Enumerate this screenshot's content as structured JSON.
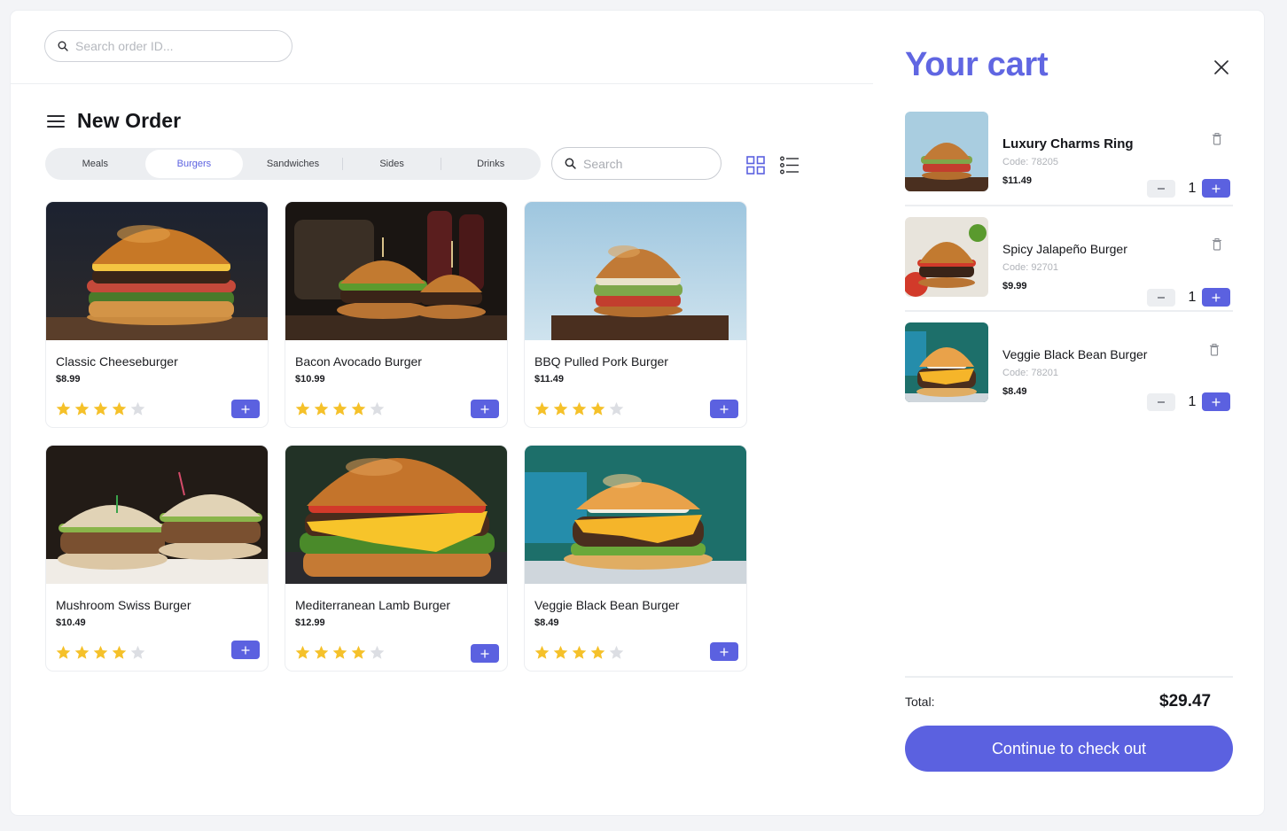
{
  "colors": {
    "accent": "#5b61e0",
    "star_filled": "#f5c12a",
    "star_empty": "#dcdee3"
  },
  "top_search": {
    "placeholder": "Search order ID..."
  },
  "page": {
    "title": "New Order"
  },
  "tabs": [
    {
      "label": "Meals",
      "active": false
    },
    {
      "label": "Burgers",
      "active": true
    },
    {
      "label": "Sandwiches",
      "active": false
    },
    {
      "label": "Sides",
      "active": false
    },
    {
      "label": "Drinks",
      "active": false
    }
  ],
  "catalog_search": {
    "placeholder": "Search"
  },
  "view_toggle": {
    "grid_icon": "grid-icon",
    "list_icon": "list-icon"
  },
  "products": [
    {
      "name": "Classic Cheeseburger",
      "price": "$8.99",
      "rating": 4
    },
    {
      "name": "Bacon Avocado Burger",
      "price": "$10.99",
      "rating": 4
    },
    {
      "name": "BBQ Pulled Pork Burger",
      "price": "$11.49",
      "rating": 4
    },
    {
      "name": "Mushroom Swiss Burger",
      "price": "$10.49",
      "rating": 4
    },
    {
      "name": "Mediterranean Lamb Burger",
      "price": "$12.99",
      "rating": 4
    },
    {
      "name": "Veggie Black Bean Burger",
      "price": "$8.49",
      "rating": 4
    }
  ],
  "cart": {
    "title": "Your cart",
    "items": [
      {
        "name": "Luxury Charms Ring",
        "code": "Code: 78205",
        "price": "$11.49",
        "qty": "1"
      },
      {
        "name": "Spicy Jalapeño Burger",
        "code": "Code: 92701",
        "price": "$9.99",
        "qty": "1"
      },
      {
        "name": "Veggie Black Bean Burger",
        "code": "Code: 78201",
        "price": "$8.49",
        "qty": "1"
      }
    ],
    "total_label": "Total:",
    "total_value": "$29.47",
    "checkout_label": "Continue to check out"
  }
}
